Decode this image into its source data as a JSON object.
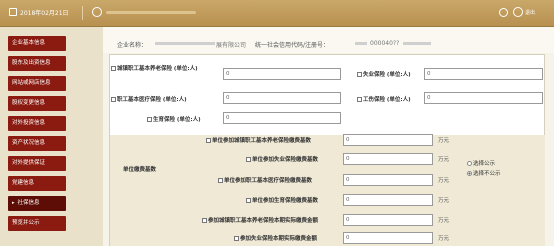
{
  "header": {
    "date": "2018年02月21日",
    "exit_label": "退出"
  },
  "sidebar": {
    "items": [
      {
        "label": "企业基本信息"
      },
      {
        "label": "股东及出资信息"
      },
      {
        "label": "网站或网店信息"
      },
      {
        "label": "股权变更信息"
      },
      {
        "label": "对外投资信息"
      },
      {
        "label": "资产状况信息"
      },
      {
        "label": "对外提供保证"
      },
      {
        "label": "党建信息"
      },
      {
        "label": "社保信息",
        "active": true
      },
      {
        "label": "预览并公示"
      }
    ]
  },
  "company": {
    "name_label": "企业名称：",
    "name_tail": "展有限公司",
    "code_label": "统一社会信用代码/注册号：",
    "code_tail": "000040??"
  },
  "insurance": {
    "pension_label": "城镇职工基本养老保险 (单位:人)",
    "unemployment_label": "失业保险 (单位:人)",
    "medical_label": "职工基本医疗保险 (单位:人)",
    "injury_label": "工伤保险 (单位:人)",
    "maternity_label": "生育保险 (单位:人)",
    "default_value": "0"
  },
  "payment_base": {
    "section_label": "单位缴费基数",
    "rows": [
      {
        "label": "单位参加城镇职工基本养老保险缴费基数",
        "value": "0",
        "unit": "万元"
      },
      {
        "label": "单位参加失业保险缴费基数",
        "value": "0",
        "unit": "万元"
      },
      {
        "label": "单位参加职工基本医疗保险缴费基数",
        "value": "0",
        "unit": "万元"
      },
      {
        "label": "单位参加生育保险缴费基数",
        "value": "0",
        "unit": "万元"
      }
    ],
    "publish_option": "选择公示",
    "nopublish_option": "选择不公示"
  },
  "actual_payment": {
    "rows": [
      {
        "label": "参加城镇职工基本养老保险本期实际缴费金额",
        "value": "0",
        "unit": "万元"
      },
      {
        "label": "参加失业保险本期实际缴费金额",
        "value": "0",
        "unit": "万元"
      }
    ]
  }
}
